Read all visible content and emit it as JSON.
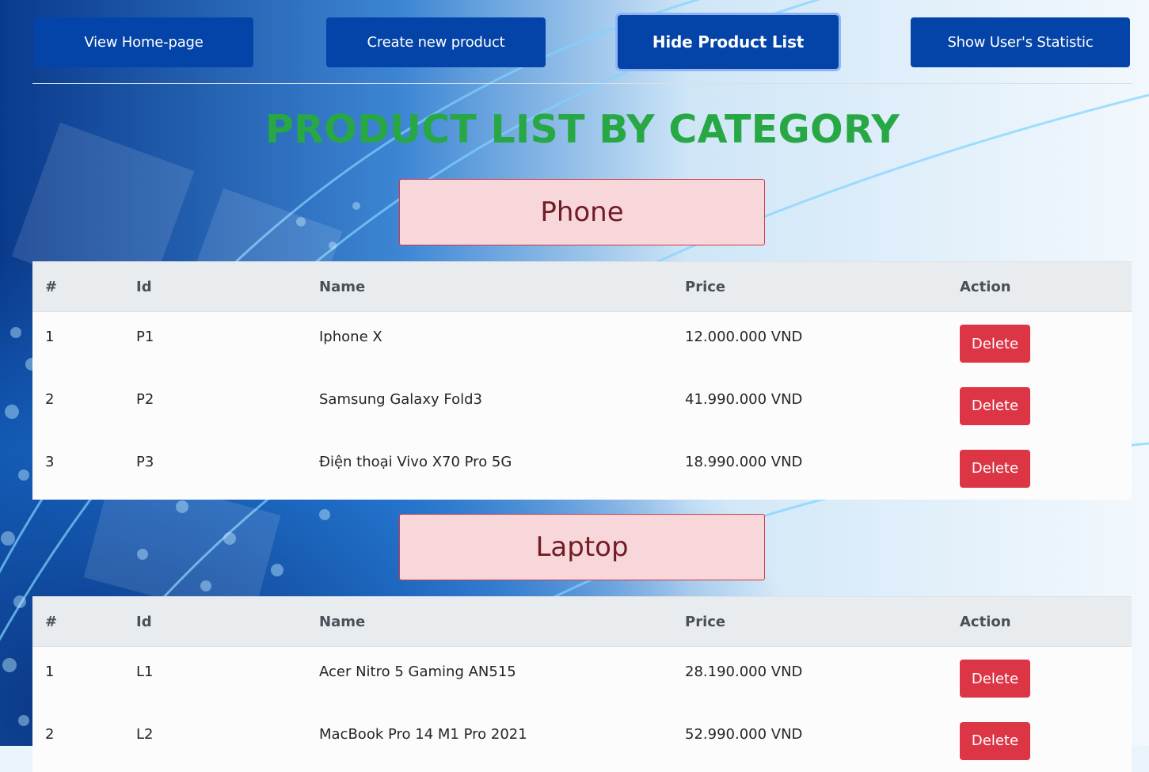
{
  "nav": {
    "home_label": "View Home-page",
    "create_label": "Create new product",
    "hide_label": "Hide Product List",
    "stats_label": "Show User's Statistic"
  },
  "title": "PRODUCT LIST BY CATEGORY",
  "columns": {
    "num": "#",
    "id": "Id",
    "name": "Name",
    "price": "Price",
    "action": "Action"
  },
  "categories": [
    {
      "name": "Phone",
      "rows": [
        {
          "num": "1",
          "id": "P1",
          "name": "Iphone X",
          "price": "12.000.000 VND",
          "action": "Delete"
        },
        {
          "num": "2",
          "id": "P2",
          "name": "Samsung Galaxy Fold3",
          "price": "41.990.000 VND",
          "action": "Delete"
        },
        {
          "num": "3",
          "id": "P3",
          "name": "Điện thoại Vivo X70 Pro 5G",
          "price": "18.990.000 VND",
          "action": "Delete"
        }
      ]
    },
    {
      "name": "Laptop",
      "rows": [
        {
          "num": "1",
          "id": "L1",
          "name": "Acer Nitro 5 Gaming AN515",
          "price": "28.190.000 VND",
          "action": "Delete"
        },
        {
          "num": "2",
          "id": "L2",
          "name": "MacBook Pro 14 M1 Pro 2021",
          "price": "52.990.000 VND",
          "action": "Delete"
        }
      ]
    }
  ],
  "colors": {
    "nav": "#0444a8",
    "title": "#28a745",
    "delete": "#dc3545",
    "category_bg": "#f8d7da"
  }
}
